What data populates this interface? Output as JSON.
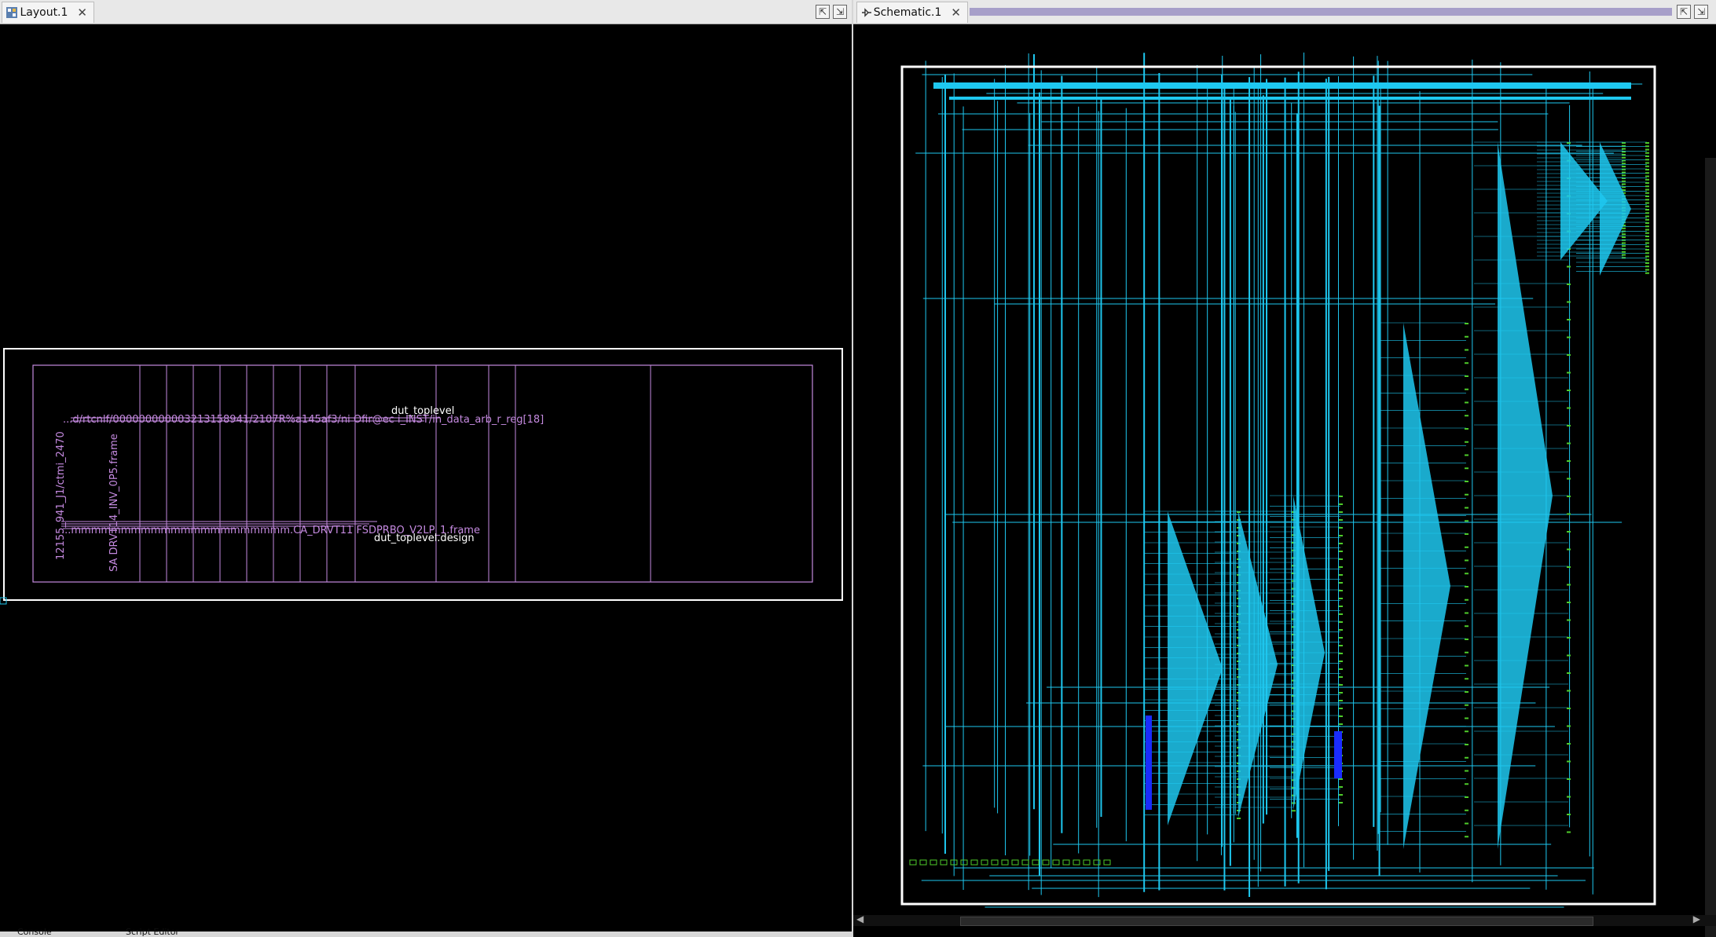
{
  "layout_pane": {
    "tab_label": "Layout.1",
    "labels": {
      "top_cell": "dut_toplevel",
      "overlap_path": "...d/rtcnlf/000000000003213158941/2107R%a145af3/ni Ofir@ec i_INST/in_data_arb_r_reg[18]",
      "frame_path": "...mmmmmmmmmmmmmmmmmmmmmm.CA_DRVT11 FSDPRBO_V2LP_1.frame",
      "design": "dut_toplevel.design",
      "vertical_1": "12155_941_J1/ctmi_2470",
      "vertical_2": "SA DRVT14_INV_0P5.frame"
    }
  },
  "schematic_pane": {
    "tab_label": "Schematic.1"
  },
  "bottom_tabs": {
    "console": "Console",
    "script_editor": "Script Editor"
  },
  "colors": {
    "layout_outline": "#c58ae0",
    "boundary": "#ffffff",
    "net": "#1ec8f0",
    "pin": "#4ecb2a",
    "bus": "#1a2cff",
    "tab_bg": "#f4f4f4"
  },
  "icons": {
    "layout_tab": "layout-icon",
    "schematic_tab": "schematic-icon",
    "close": "close-icon",
    "float": "float-window-icon",
    "maximize": "maximize-icon"
  }
}
